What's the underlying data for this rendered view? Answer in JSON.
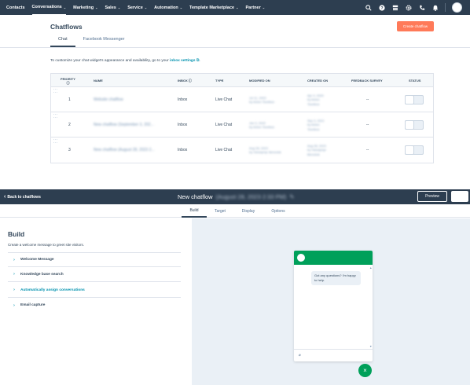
{
  "topnav": {
    "items": [
      {
        "label": "Contacts",
        "caret": false,
        "active": false
      },
      {
        "label": "Conversations",
        "caret": true,
        "active": true
      },
      {
        "label": "Marketing",
        "caret": true,
        "active": false
      },
      {
        "label": "Sales",
        "caret": true,
        "active": false
      },
      {
        "label": "Service",
        "caret": true,
        "active": false
      },
      {
        "label": "Automation",
        "caret": true,
        "active": false
      },
      {
        "label": "Template Marketplace",
        "caret": true,
        "active": false
      },
      {
        "label": "Partner",
        "caret": true,
        "active": false
      }
    ],
    "caret_glyph": "⌄",
    "icons": [
      "search-icon",
      "help-icon",
      "marketplace-icon",
      "settings-icon",
      "calling-icon",
      "notifications-icon",
      "account-avatar"
    ]
  },
  "chatflows": {
    "title": "Chatflows",
    "create_button": "Create chatflow",
    "tabs": [
      {
        "label": "Chat",
        "active": true
      },
      {
        "label": "Facebook Messenger",
        "active": false
      }
    ],
    "info": {
      "prefix": "To customize your chat widget's appearance and availability, go to your ",
      "link": "inbox settings",
      "link_icon": "⧉",
      "suffix": "."
    },
    "table": {
      "headers": {
        "priority": "PRIORITY",
        "priority_icon": "ⓘ",
        "name": "NAME",
        "inbox": "INBOX ⓘ",
        "type": "TYPE",
        "modified_on": "MODIFIED ON",
        "created_on": "CREATED ON",
        "feedback_survey": "FEEDBACK SURVEY",
        "status": "STATUS"
      },
      "rows": [
        {
          "priority": "1",
          "name": "Website chatflow",
          "inbox": "Inbox",
          "type": "Live Chat",
          "modified_date": "Jul 11, 2023",
          "modified_by": "by Anton Tsvetkov",
          "created_date": "Apr 4, 2020",
          "created_by": "by Anton",
          "created_by_2": "Tsvetkov",
          "feedback": "--",
          "status_on": false
        },
        {
          "priority": "2",
          "name": "New chatflow (September 3, 202...",
          "inbox": "Inbox",
          "type": "Live Chat",
          "modified_date": "Jan 3, 2022",
          "modified_by": "by Anton Tsvetkov",
          "created_date": "Sep 3, 2021",
          "created_by": "by Anton",
          "created_by_2": "Tsvetkov",
          "feedback": "--",
          "status_on": false
        },
        {
          "priority": "3",
          "name": "New chatflow (August 28, 2023 2...",
          "inbox": "Inbox",
          "type": "Live Chat",
          "modified_date": "Aug 28, 2023",
          "modified_by": "by Volodymyr Bereziuk",
          "created_date": "Aug 28, 2023",
          "created_by": "by Volodymyr",
          "created_by_2": "Bereziuk",
          "feedback": "--",
          "status_on": false
        }
      ]
    }
  },
  "editor": {
    "back_label": "Back to chatflows",
    "title": "New chatflow",
    "title_suffix": "(August 28, 2023 2:33 PM)",
    "edit_icon": "✎",
    "preview_button": "Preview",
    "tabs": [
      {
        "label": "Build",
        "active": true
      },
      {
        "label": "Target",
        "active": false
      },
      {
        "label": "Display",
        "active": false
      },
      {
        "label": "Options",
        "active": false
      }
    ],
    "build": {
      "title": "Build",
      "description": "Create a welcome message to greet site visitors.",
      "items": [
        {
          "label": "Welcome Message",
          "highlight": false
        },
        {
          "label": "Knowledge base search",
          "highlight": false
        },
        {
          "label": "Automatically assign conversations",
          "highlight": true
        },
        {
          "label": "Email capture",
          "highlight": false
        }
      ],
      "chevron": "›"
    },
    "preview": {
      "bubble_text": "Got any questions? I'm happy to help.",
      "attach_icon": "⌀",
      "launcher_icon": "×",
      "brand_color": "#00a05a"
    }
  },
  "colors": {
    "nav_bg": "#2d3e50",
    "accent_orange": "#ff7a59",
    "link_teal": "#0091ae",
    "text_dark": "#33475b"
  }
}
